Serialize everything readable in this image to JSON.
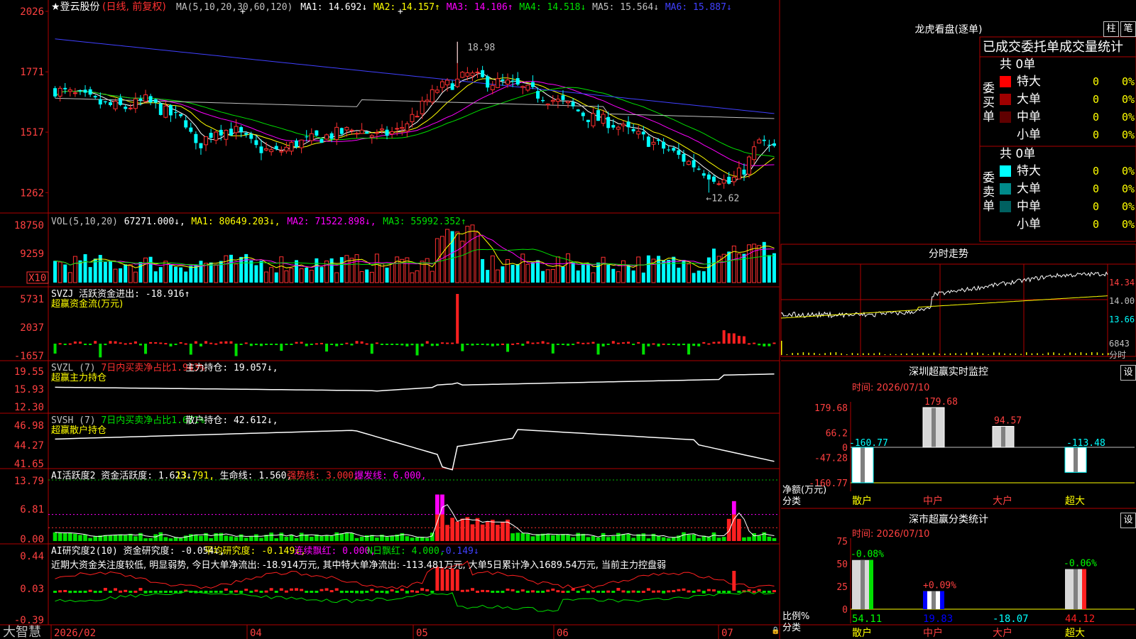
{
  "app": {
    "name": "大智慧",
    "scroll_lock": "🔒"
  },
  "stock": {
    "name": "★登云股份",
    "mode": "(日线, 前复权)"
  },
  "ma_line": {
    "head": "MA(5,10,20,30,60,120)",
    "items": [
      {
        "label": "MA1: 14.692↓",
        "color": "#ffffff"
      },
      {
        "label": "MA2: 14.157↑",
        "color": "#ffff00"
      },
      {
        "label": "MA3: 14.106↑",
        "color": "#ff00ff"
      },
      {
        "label": "MA4: 14.518↓",
        "color": "#00e000"
      },
      {
        "label": "MA5: 15.564↓",
        "color": "#c0c0c0"
      },
      {
        "label": "MA6: 15.887↓",
        "color": "#4040ff"
      }
    ]
  },
  "price_axis": [
    "2026",
    "1771",
    "1517",
    "1262"
  ],
  "price_marks": {
    "high": "18.98",
    "low": "←12.62"
  },
  "vol_line": {
    "head": "VOL(5,10,20)",
    "items": [
      {
        "label": "67271.000↓,",
        "color": "#ffffff"
      },
      {
        "label": "MA1: 80649.203↓,",
        "color": "#ffff00"
      },
      {
        "label": "MA2: 71522.898↓,",
        "color": "#ff00ff"
      },
      {
        "label": "MA3: 55992.352↑",
        "color": "#00e000"
      }
    ],
    "axis": [
      "18750",
      "9259"
    ],
    "unit": "X10"
  },
  "svzj": {
    "line1": "SVZJ  活跃资金进出: -18.916↑",
    "line2": "超赢资金流(万元)",
    "axis": [
      "5731",
      "2037",
      "-1657"
    ]
  },
  "svzl": {
    "head": "SVZL (7)",
    "items": [
      {
        "label": "7日内买卖净占比1.943%",
        "color": "#ff3030"
      },
      {
        "label": "主力持仓: 19.057↓,",
        "color": "#ffffff"
      }
    ],
    "line2": "超赢主力持仓",
    "axis": [
      "19.55",
      "15.93",
      "12.30"
    ]
  },
  "svsh": {
    "head": "SVSH (7)",
    "items": [
      {
        "label": "7日内买卖净占比1.671%",
        "color": "#00e000"
      },
      {
        "label": "散户持仓: 42.612↓,",
        "color": "#ffffff"
      }
    ],
    "line2": "超赢散户持仓",
    "axis": [
      "46.98",
      "44.27",
      "41.65"
    ]
  },
  "ai_active": {
    "items": [
      {
        "label": "AI活跃度2 资金活跃度: 1.623↓,",
        "color": "#ffffff"
      },
      {
        "label": "13.791,",
        "color": "#ffff00"
      },
      {
        "label": "生命线: 1.560,",
        "color": "#ffffff"
      },
      {
        "label": "强势线: 3.000,",
        "color": "#ff3030"
      },
      {
        "label": "爆发线: 6.000,",
        "color": "#ff00ff"
      }
    ],
    "axis": [
      "13.79",
      "6.81",
      "0.00"
    ]
  },
  "ai_research": {
    "items": [
      {
        "label": "AI研究度2(10) 资金研究度: -0.054↓,",
        "color": "#ffffff"
      },
      {
        "label": "平均研究度: -0.149↓,",
        "color": "#ffff00"
      },
      {
        "label": "连续飘红: 0.000,",
        "color": "#ff00ff"
      },
      {
        "label": "N日飘红: 4.000,",
        "color": "#00e000"
      },
      {
        "label": "-0.149↓",
        "color": "#4040ff"
      }
    ],
    "comment": "近期大资金关注度较低, 明显弱势, 今日大单净流出: -18.914万元, 其中特大单净流出: -113.481万元, 大单5日累计净入1689.54万元, 当前主力控盘弱",
    "axis": [
      "0.44",
      "0.03",
      "-0.39"
    ]
  },
  "dates": [
    "2026/02",
    "04",
    "05",
    "06",
    "07"
  ],
  "lhb": {
    "title": "龙虎看盘(逐单)",
    "btn1": "柱",
    "btn2": "笔",
    "subtitle": "已成交委托单成交量统计",
    "buy": {
      "side": "委买单",
      "total": "共 0单",
      "rows": [
        {
          "name": "特大",
          "count": "0",
          "pct": "0%",
          "color": "#ff0000"
        },
        {
          "name": "大单",
          "count": "0",
          "pct": "0%",
          "color": "#a00000"
        },
        {
          "name": "中单",
          "count": "0",
          "pct": "0%",
          "color": "#600000"
        },
        {
          "name": "小单",
          "count": "0",
          "pct": "0%",
          "color": "#000000"
        }
      ]
    },
    "sell": {
      "side": "委卖单",
      "total": "共 0单",
      "rows": [
        {
          "name": "特大",
          "count": "0",
          "pct": "0%",
          "color": "#00ffff"
        },
        {
          "name": "大单",
          "count": "0",
          "pct": "0%",
          "color": "#008a8a"
        },
        {
          "name": "中单",
          "count": "0",
          "pct": "0%",
          "color": "#006060"
        },
        {
          "name": "小单",
          "count": "0",
          "pct": "0%",
          "color": "#000000"
        }
      ]
    }
  },
  "intraday": {
    "title": "分时走势",
    "axis": [
      "14.34",
      "14.00",
      "13.66"
    ],
    "vol": "6843",
    "vol_label": "分时"
  },
  "sz_monitor": {
    "title": "深圳超赢实时监控",
    "set_btn": "设",
    "time": "时间: 2026/07/10",
    "axis": [
      "179.68",
      "66.2",
      "0",
      "-47.28",
      "-160.77"
    ],
    "ylabel": "净额(万元)",
    "xlabel": "分类",
    "categories": [
      "散户",
      "中户",
      "大户",
      "超大"
    ],
    "values": [
      -160.77,
      179.68,
      94.57,
      -113.48
    ],
    "value_labels": [
      "-160.77",
      "179.68",
      "94.57",
      "-113.48"
    ]
  },
  "sz_class": {
    "title": "深市超赢分类统计",
    "set_btn": "设",
    "time": "时间: 2026/07/10",
    "axis": [
      "75",
      "50",
      "25",
      "0"
    ],
    "ylabel": "比例%",
    "xlabel": "分类",
    "categories": [
      "散户",
      "中户",
      "大户",
      "超大"
    ],
    "values": [
      54.11,
      19.83,
      -18.07,
      44.12
    ],
    "value_labels": [
      "54.11",
      "19.83",
      "-18.07",
      "44.12"
    ],
    "changes": [
      "-0.08%",
      "+0.09%",
      "",
      "-0.06%"
    ]
  },
  "colors": {
    "up": "#ff3030",
    "down": "#00ffff",
    "panel_border": "#b00000",
    "axis_text": "#ff4040"
  },
  "chart_data": [
    {
      "type": "candlestick",
      "id": "price",
      "ylim": [
        12.0,
        20.5
      ],
      "ohlc_note": "daily OHLC estimated in script",
      "ma_lines": [
        "MA1",
        "MA2",
        "MA3",
        "MA4",
        "MA5",
        "MA6"
      ],
      "high": 18.98,
      "low": 12.62
    },
    {
      "type": "bar",
      "id": "sz_monitor",
      "categories": [
        "散户",
        "中户",
        "大户",
        "超大"
      ],
      "values": [
        -160.77,
        179.68,
        94.57,
        -113.48
      ],
      "ylim": [
        -160.77,
        179.68
      ]
    },
    {
      "type": "bar",
      "id": "sz_class",
      "categories": [
        "散户",
        "中户",
        "大户",
        "超大"
      ],
      "values": [
        54.11,
        19.83,
        -18.07,
        44.12
      ],
      "ylim": [
        0,
        75
      ]
    }
  ]
}
